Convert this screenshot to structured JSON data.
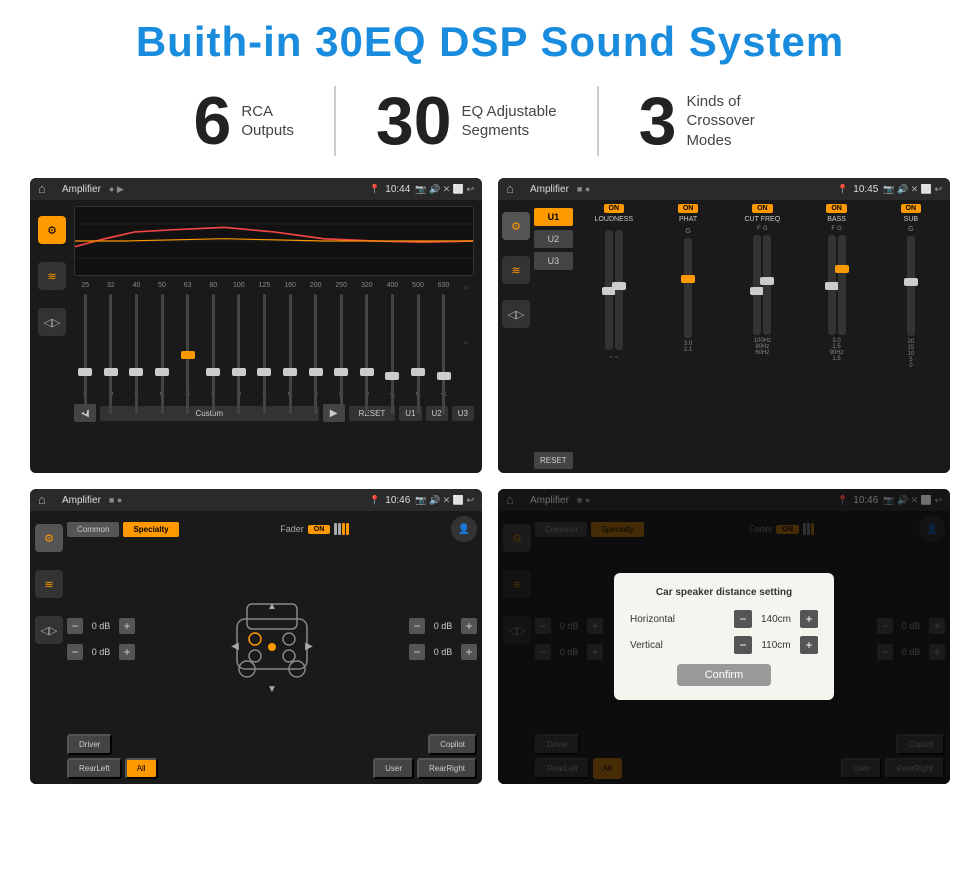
{
  "title": "Buith-in 30EQ DSP Sound System",
  "stats": [
    {
      "number": "6",
      "label": "RCA\nOutputs"
    },
    {
      "number": "30",
      "label": "EQ Adjustable\nSegments"
    },
    {
      "number": "3",
      "label": "Kinds of\nCrossover Modes"
    }
  ],
  "screens": [
    {
      "id": "eq-screen",
      "title": "Amplifier",
      "time": "10:44",
      "type": "eq"
    },
    {
      "id": "crossover-screen",
      "title": "Amplifier",
      "time": "10:45",
      "type": "crossover"
    },
    {
      "id": "fader-screen",
      "title": "Amplifier",
      "time": "10:46",
      "type": "fader"
    },
    {
      "id": "dialog-screen",
      "title": "Amplifier",
      "time": "10:46",
      "type": "dialog",
      "dialog": {
        "title": "Car speaker distance setting",
        "horizontal_label": "Horizontal",
        "horizontal_value": "140cm",
        "vertical_label": "Vertical",
        "vertical_value": "110cm",
        "confirm_label": "Confirm"
      }
    }
  ],
  "eq": {
    "freqs": [
      "25",
      "32",
      "40",
      "50",
      "63",
      "80",
      "100",
      "125",
      "160",
      "200",
      "250",
      "320",
      "400",
      "500",
      "630"
    ],
    "values": [
      "0",
      "0",
      "0",
      "0",
      "5",
      "0",
      "0",
      "0",
      "0",
      "0",
      "0",
      "0",
      "-1",
      "0",
      "-1"
    ],
    "presets": [
      "◀",
      "Custom",
      "▶",
      "RESET",
      "U1",
      "U2",
      "U3"
    ]
  },
  "crossover": {
    "tabs": [
      "U1",
      "U2",
      "U3"
    ],
    "channels": [
      "LOUDNESS",
      "PHAT",
      "CUT FREQ",
      "BASS",
      "SUB"
    ],
    "reset_label": "RESET"
  },
  "fader": {
    "tabs": [
      "Common",
      "Specialty"
    ],
    "fader_label": "Fader",
    "on_label": "ON",
    "db_values": [
      "0 dB",
      "0 dB",
      "0 dB",
      "0 dB"
    ],
    "buttons": [
      "Driver",
      "Copilot",
      "RearLeft",
      "All",
      "User",
      "RearRight"
    ]
  }
}
